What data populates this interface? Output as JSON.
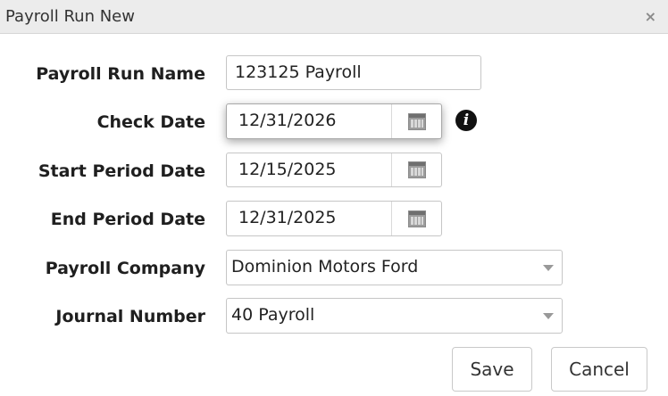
{
  "dialog": {
    "title": "Payroll Run New",
    "close_label": "×"
  },
  "form": {
    "payroll_run_name_label": "Payroll Run Name",
    "payroll_run_name_value": "123125 Payroll",
    "check_date_label": "Check Date",
    "check_date_value": "12/31/2026",
    "start_period_date_label": "Start Period Date",
    "start_period_date_value": "12/15/2025",
    "end_period_date_label": "End Period Date",
    "end_period_date_value": "12/31/2025",
    "payroll_company_label": "Payroll Company",
    "payroll_company_value": "Dominion Motors Ford",
    "journal_number_label": "Journal Number",
    "journal_number_value": "40 Payroll",
    "info_icon_glyph": "i"
  },
  "buttons": {
    "save_label": "Save",
    "cancel_label": "Cancel"
  },
  "icons": {
    "calendar": "calendar-icon",
    "info": "info-icon",
    "dropdown": "chevron-down-icon",
    "close": "close-icon"
  }
}
